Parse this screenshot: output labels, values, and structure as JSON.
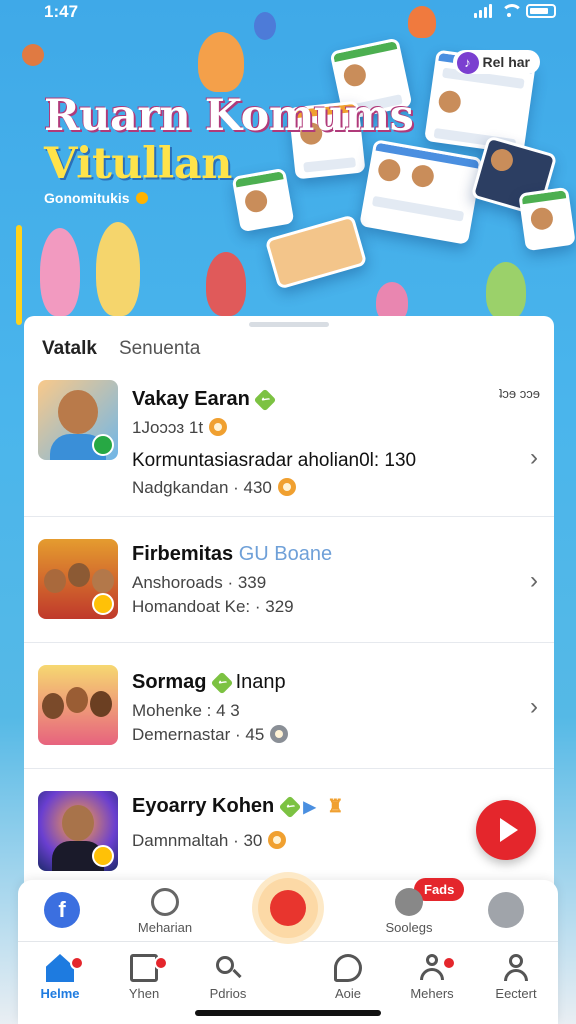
{
  "status_bar": {
    "time": "1:47"
  },
  "hero": {
    "title_line1": "Ruarn Komums",
    "title_line2": "Vitullan",
    "subtitle": "Gonomitukis",
    "tag": "Rel har"
  },
  "tabs": [
    {
      "label": "Vatalk",
      "active": true
    },
    {
      "label": "Senuenta",
      "active": false
    }
  ],
  "rows": [
    {
      "title": "Vakay Earan",
      "date": "ʇɔɘ  ɔɔɘ",
      "line1": "1Joɔɔɜ 1t",
      "line2": "Kormuntasiasradar aholian0l: 130",
      "line3": "Nadgkandan · 430",
      "thumb_color": "#f2b26b",
      "badge_color": "#27a844"
    },
    {
      "title": "Firbemitas",
      "title_accent": "GU Boane",
      "line1": "Anshoroads · 339",
      "line2": "Homandoat Ke: · 329",
      "thumb_color": "#e59c2f",
      "badge_color": "#ffc107"
    },
    {
      "title": "Sormag",
      "title_tail": "Inanp",
      "line1": "Mohenke : 4 3",
      "line2": "Demernastar · 45",
      "thumb_color": "#f4d56b"
    },
    {
      "title": "Eyoarry Kohen",
      "line1": "Damnmaltah · 30",
      "thumb_color": "#1d2a6b",
      "badge_color": "#ffc107"
    }
  ],
  "dock": {
    "left_label": "Meharian",
    "right_label": "Soolegs",
    "pill": "Fads"
  },
  "nav": [
    {
      "label": "Helme",
      "icon": "home-icon",
      "active": true,
      "dot": true
    },
    {
      "label": "Yhen",
      "icon": "image-icon",
      "active": false,
      "dot": true
    },
    {
      "label": "Pdrios",
      "icon": "search-icon",
      "active": false,
      "dot": false
    },
    {
      "label": "Aoie",
      "icon": "chat-icon",
      "active": false,
      "dot": false
    },
    {
      "label": "Mehers",
      "icon": "people-icon",
      "active": false,
      "dot": true
    },
    {
      "label": "Eectert",
      "icon": "profile-icon",
      "active": false,
      "dot": false
    }
  ],
  "colors": {
    "accent_blue": "#1e7be0",
    "red": "#e4262c",
    "green": "#7cc242"
  }
}
